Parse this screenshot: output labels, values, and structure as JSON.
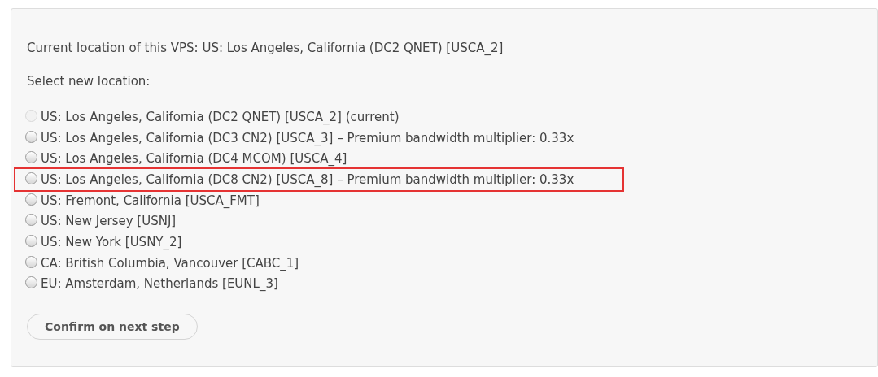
{
  "current_location": "Current location of this VPS: US: Los Angeles, California (DC2 QNET) [USCA_2]",
  "select_label": "Select new location:",
  "locations": [
    {
      "label": "US: Los Angeles, California (DC2 QNET) [USCA_2] (current)",
      "disabled": true,
      "selected": false,
      "highlighted": false
    },
    {
      "label": "US: Los Angeles, California (DC3 CN2) [USCA_3] – Premium bandwidth multiplier: 0.33x",
      "disabled": false,
      "selected": false,
      "highlighted": false
    },
    {
      "label": "US: Los Angeles, California (DC4 MCOM) [USCA_4]",
      "disabled": false,
      "selected": false,
      "highlighted": false
    },
    {
      "label": "US: Los Angeles, California (DC8 CN2) [USCA_8] – Premium bandwidth multiplier: 0.33x",
      "disabled": false,
      "selected": false,
      "highlighted": true
    },
    {
      "label": "US: Fremont, California [USCA_FMT]",
      "disabled": false,
      "selected": false,
      "highlighted": false
    },
    {
      "label": "US: New Jersey [USNJ]",
      "disabled": false,
      "selected": false,
      "highlighted": false
    },
    {
      "label": "US: New York [USNY_2]",
      "disabled": false,
      "selected": false,
      "highlighted": false
    },
    {
      "label": "CA: British Columbia, Vancouver [CABC_1]",
      "disabled": false,
      "selected": false,
      "highlighted": false
    },
    {
      "label": "EU: Amsterdam, Netherlands [EUNL_3]",
      "disabled": false,
      "selected": false,
      "highlighted": false
    }
  ],
  "confirm_button": "Confirm on next step"
}
